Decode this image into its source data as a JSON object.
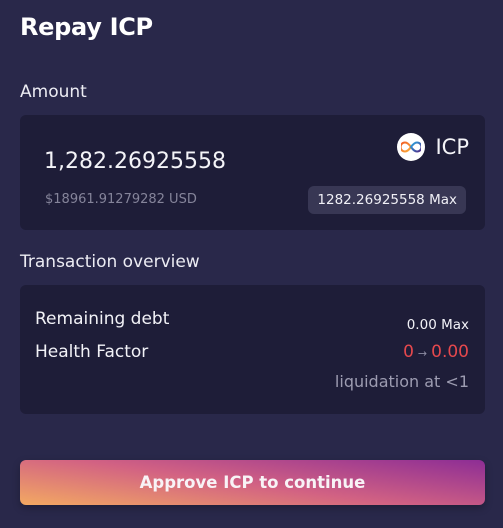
{
  "modal": {
    "title": "Repay ICP"
  },
  "amount": {
    "label": "Amount",
    "value": "1,282.26925558",
    "usd": "$18961.91279282 USD",
    "asset_symbol": "ICP",
    "asset_icon": "icp-logo-icon",
    "max_value": "1282.26925558",
    "max_label": "Max"
  },
  "overview": {
    "label": "Transaction overview",
    "remaining_debt_label": "Remaining debt",
    "remaining_debt_value": "0.00",
    "remaining_debt_suffix": "Max",
    "health_factor_label": "Health Factor",
    "health_factor_from": "0",
    "health_factor_arrow": "→",
    "health_factor_to": "0.00",
    "liquidation_note": "liquidation at <1"
  },
  "actions": {
    "approve_label": "Approve ICP to continue"
  },
  "colors": {
    "background": "#29284a",
    "card": "#1e1d38",
    "danger": "#e5484d",
    "gradient_start": "#f3a962",
    "gradient_mid": "#d26283",
    "gradient_end": "#8d2d95"
  }
}
